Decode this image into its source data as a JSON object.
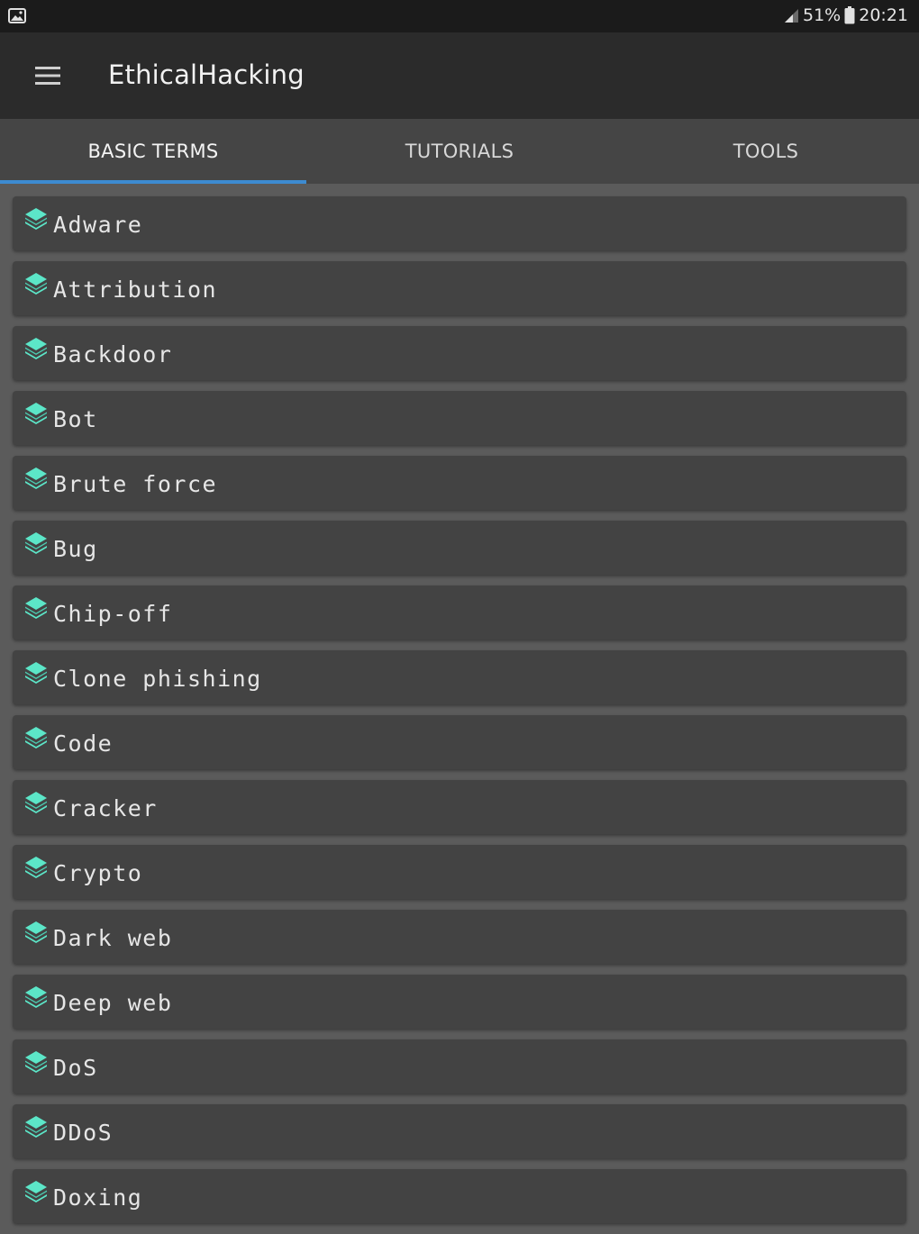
{
  "status_bar": {
    "battery": "51%",
    "time": "20:21"
  },
  "app_bar": {
    "title": "EthicalHacking"
  },
  "tabs": [
    {
      "label": "BASIC TERMS",
      "active": true
    },
    {
      "label": "TUTORIALS",
      "active": false
    },
    {
      "label": "TOOLS",
      "active": false
    }
  ],
  "colors": {
    "accent": "#3d8bd1",
    "icon": "#5ce6c8"
  },
  "terms": [
    {
      "label": "Adware"
    },
    {
      "label": "Attribution"
    },
    {
      "label": "Backdoor"
    },
    {
      "label": "Bot"
    },
    {
      "label": "Brute force"
    },
    {
      "label": "Bug"
    },
    {
      "label": "Chip-off"
    },
    {
      "label": "Clone phishing"
    },
    {
      "label": "Code"
    },
    {
      "label": "Cracker"
    },
    {
      "label": "Crypto"
    },
    {
      "label": "Dark web"
    },
    {
      "label": "Deep web"
    },
    {
      "label": "DoS"
    },
    {
      "label": "DDoS"
    },
    {
      "label": "Doxing"
    }
  ]
}
